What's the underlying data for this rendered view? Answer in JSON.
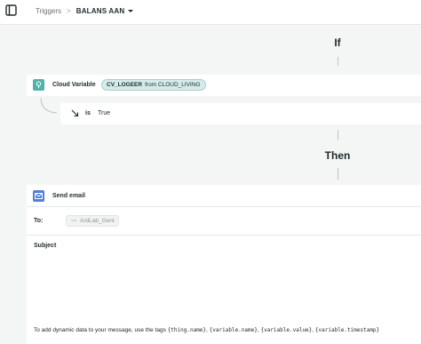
{
  "breadcrumb": {
    "parent": "Triggers",
    "separator": ">",
    "current": "BALANS AAN"
  },
  "sections": {
    "if_label": "If",
    "then_label": "Then"
  },
  "condition": {
    "title": "Cloud Variable",
    "variable_name": "CV_LOGEER",
    "variable_source": "from CLOUD_LIVING",
    "operator": "is",
    "value": "True"
  },
  "action": {
    "title": "Send email",
    "to_label": "To:",
    "to_value": "ArdLab_Gent",
    "subject_label": "Subject",
    "subject_value": "",
    "help_prefix": "To add dynamic data to your message, use the tags",
    "tags": [
      "{thing.name}",
      "{variable.name}",
      "{variable.value}",
      "{variable.timestamp}"
    ]
  },
  "colors": {
    "accent_teal": "#4fb3ab",
    "email_blue": "#4f7fd9",
    "pill_bg": "#d5ebe9"
  },
  "icons": {
    "sidebar_toggle": "sidebar-toggle-icon",
    "cloud_variable": "cloud-variable-icon",
    "operator": "arrow-down-right-icon",
    "email": "envelope-icon",
    "recipient": "key-icon"
  }
}
